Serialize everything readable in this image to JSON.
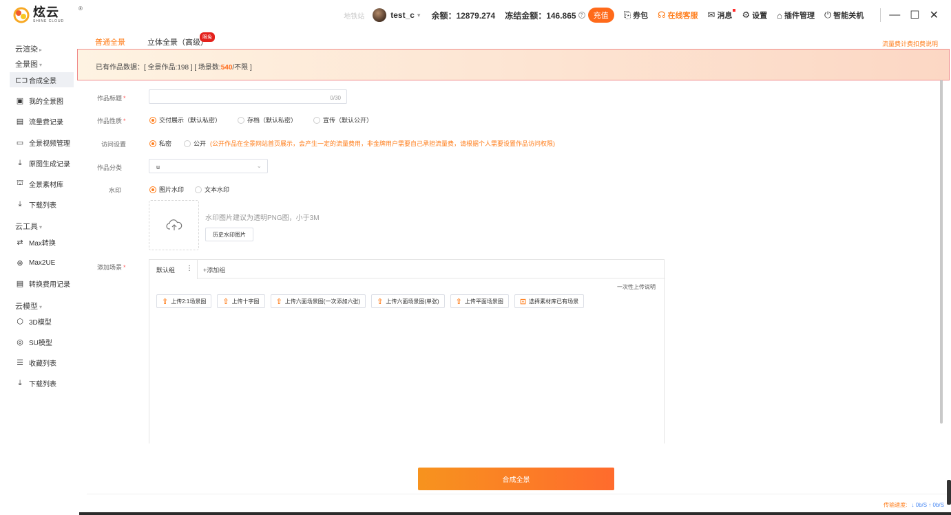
{
  "logo": {
    "cn": "炫云",
    "en": "SHINE CLOUD",
    "reg": "®"
  },
  "topbar": {
    "faint_text": "地铁站",
    "username": "test_c",
    "balance": "余额：12879.274",
    "frozen": "冻结金额：146.865",
    "recharge": "充值",
    "coupon": "券包",
    "service": "在线客服",
    "message": "消息",
    "settings": "设置",
    "plugins": "插件管理",
    "shutdown": "智能关机"
  },
  "sidebar": {
    "sec_render": "云渲染",
    "sec_pano": "全景图",
    "pano_items": [
      "合成全景",
      "我的全景图",
      "流量费记录",
      "全景视频管理",
      "原图生成记录",
      "全景素材库",
      "下载列表"
    ],
    "sec_tools": "云工具",
    "tool_items": [
      "Max转换",
      "Max2UE",
      "转换费用记录"
    ],
    "sec_model": "云模型",
    "model_items": [
      "3D模型",
      "SU模型",
      "收藏列表",
      "下载列表"
    ]
  },
  "tabs": {
    "normal": "普通全景",
    "stereo": "立体全景（高级）",
    "badge": "限免",
    "flow_link": "流量费计费扣费说明"
  },
  "notice": {
    "prefix": "已有作品数据：[ 全景作品:198 ] [ 场景数:",
    "highlight": "540",
    "suffix": "/不限 ]"
  },
  "form": {
    "title_label": "作品标题",
    "title_counter": "0/30",
    "nature_label": "作品性质",
    "nature_options": [
      "交付展示（默认私密）",
      "存档（默认私密）",
      "宣传（默认公开）"
    ],
    "access_label": "访问设置",
    "access_options": [
      "私密",
      "公开"
    ],
    "access_hint": "(公开作品在全景网站首页展示，会产生一定的流量费用，非金牌用户需要自己承担流量费，请根据个人需要设置作品访问权限)",
    "category_label": "作品分类",
    "category_value": "u",
    "watermark_label": "水印",
    "watermark_options": [
      "图片水印",
      "文本水印"
    ],
    "watermark_hint": "水印图片建议为透明PNG图，小于3M",
    "watermark_history": "历史水印图片",
    "scene_label": "添加场景",
    "scene_tab": "默认组",
    "scene_add": "+添加组",
    "oneshot": "一次性上传说明",
    "upload_buttons": [
      "上传2:1场景图",
      "上传十字图",
      "上传六面场景图(一次添加六张)",
      "上传六面场景图(单张)",
      "上传平面场景图",
      "选择素材库已有场景"
    ],
    "submit": "合成全景"
  },
  "status": {
    "speed_label": "传输速度:",
    "speed_value": "↓ 0b/S ↑ 0b/S"
  }
}
